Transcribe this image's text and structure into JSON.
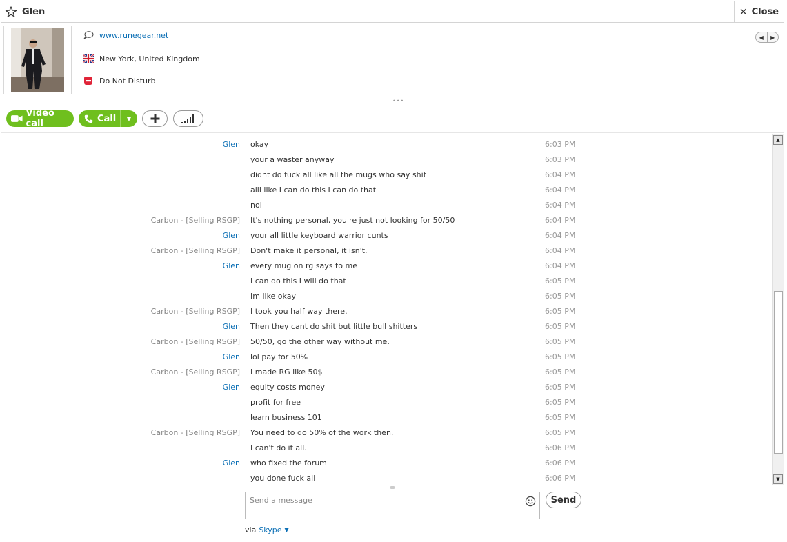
{
  "window": {
    "title": "Glen",
    "close_label": "Close"
  },
  "profile": {
    "website": "www.runegear.net",
    "location": "New York, United Kingdom",
    "status": "Do Not Disturb"
  },
  "actions": {
    "video_call_label": "Video call",
    "call_label": "Call"
  },
  "messages": [
    {
      "sender": "Glen",
      "text": "okay",
      "time": "6:03 PM"
    },
    {
      "sender": "",
      "text": "your a waster anyway",
      "time": "6:03 PM"
    },
    {
      "sender": "",
      "text": "didnt do fuck all like all the mugs who say shit",
      "time": "6:04 PM"
    },
    {
      "sender": "",
      "text": "alll like I can do this I can do that",
      "time": "6:04 PM"
    },
    {
      "sender": "",
      "text": "noi",
      "time": "6:04 PM"
    },
    {
      "sender": "Carbon - [Selling RSGP]",
      "text": "It's nothing personal, you're just not looking for 50/50",
      "time": "6:04 PM"
    },
    {
      "sender": "Glen",
      "text": "your all little keyboard warrior cunts",
      "time": "6:04 PM"
    },
    {
      "sender": "Carbon - [Selling RSGP]",
      "text": "Don't make it personal, it isn't.",
      "time": "6:04 PM"
    },
    {
      "sender": "Glen",
      "text": "every mug on rg says to me",
      "time": "6:04 PM"
    },
    {
      "sender": "",
      "text": "I can do this I will do that",
      "time": "6:05 PM"
    },
    {
      "sender": "",
      "text": "Im like okay",
      "time": "6:05 PM"
    },
    {
      "sender": "Carbon - [Selling RSGP]",
      "text": "I took you half way there.",
      "time": "6:05 PM"
    },
    {
      "sender": "Glen",
      "text": "Then they cant do shit but little bull shitters",
      "time": "6:05 PM"
    },
    {
      "sender": "Carbon - [Selling RSGP]",
      "text": "50/50, go the other way without me.",
      "time": "6:05 PM"
    },
    {
      "sender": "Glen",
      "text": "lol pay for 50%",
      "time": "6:05 PM"
    },
    {
      "sender": "Carbon - [Selling RSGP]",
      "text": "I made RG like 50$",
      "time": "6:05 PM"
    },
    {
      "sender": "Glen",
      "text": "equity costs money",
      "time": "6:05 PM"
    },
    {
      "sender": "",
      "text": "profit for free",
      "time": "6:05 PM"
    },
    {
      "sender": "",
      "text": "learn business 101",
      "time": "6:05 PM"
    },
    {
      "sender": "Carbon - [Selling RSGP]",
      "text": "You need to do 50% of the work then.",
      "time": "6:05 PM"
    },
    {
      "sender": "",
      "text": "I can't do it all.",
      "time": "6:06 PM"
    },
    {
      "sender": "Glen",
      "text": "who fixed the forum",
      "time": "6:06 PM"
    },
    {
      "sender": "",
      "text": "you done fuck all",
      "time": "6:06 PM"
    }
  ],
  "composer": {
    "placeholder": "Send a message",
    "send_label": "Send",
    "via_label": "via",
    "service": "Skype"
  },
  "colors": {
    "accent_green": "#6fbf1e",
    "link_blue": "#0b6fb5"
  }
}
